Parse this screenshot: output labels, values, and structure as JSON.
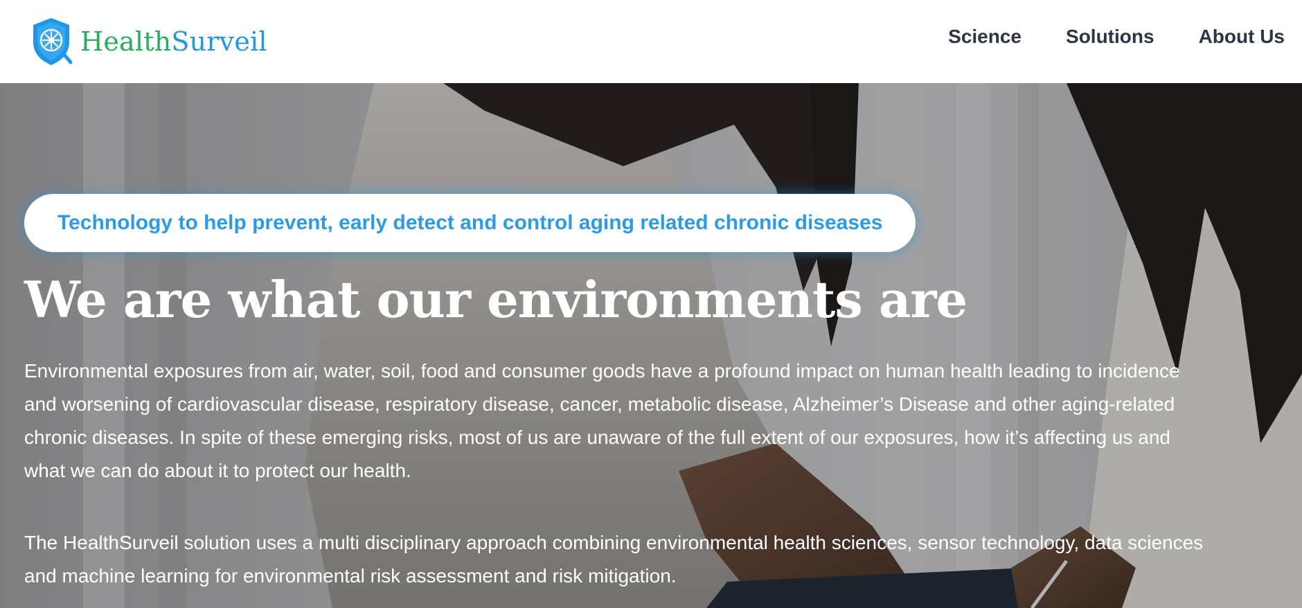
{
  "header": {
    "brand": {
      "name_part_a": "Health",
      "name_part_b": "Surveil",
      "logo_icon": "shield-snowflake-icon",
      "colors": {
        "green": "#20b15a",
        "blue": "#2196e8"
      }
    },
    "nav": [
      {
        "label": "Science"
      },
      {
        "label": "Solutions"
      },
      {
        "label": "About Us"
      }
    ]
  },
  "hero": {
    "tagline": "Technology to help prevent, early detect and control aging related chronic diseases",
    "title": "We are what our environments are",
    "paragraphs": [
      "Environmental exposures from air, water, soil, food and consumer goods have a profound impact on human health leading to incidence and worsening of cardiovascular disease, respiratory disease, cancer, metabolic disease, Alzheimer’s Disease and other aging-related chronic diseases. In spite of these emerging risks, most of us are unaware of the full extent of our exposures, how it’s affecting us and what we can do about it to protect our health.",
      "The HealthSurveil solution uses a multi disciplinary approach combining environmental health sciences, sensor technology, data sciences and machine learning for environmental risk assessment and risk mitigation."
    ],
    "accent_color": "#2b9be9"
  }
}
